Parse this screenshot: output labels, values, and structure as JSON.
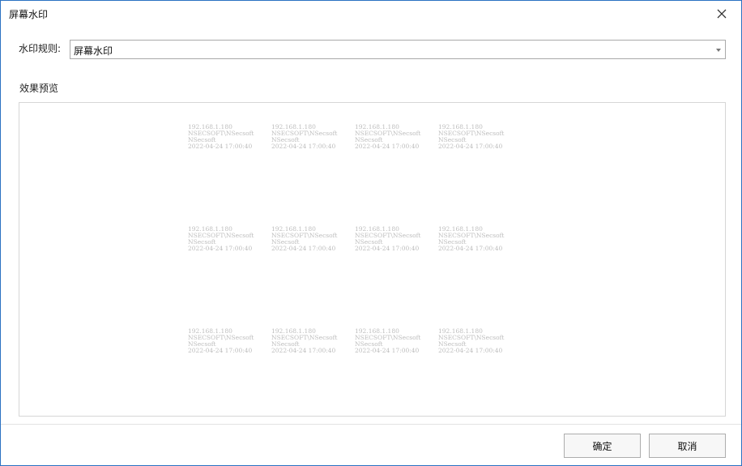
{
  "window": {
    "title": "屏幕水印"
  },
  "rule": {
    "label": "水印规则:",
    "selected": "屏幕水印"
  },
  "preview": {
    "label": "效果预览",
    "watermark_lines": [
      "192.168.1.180",
      "NSECSOFT\\NSecsoft",
      "NSecsoft",
      "2022-04-24 17:00:40"
    ]
  },
  "footer": {
    "ok_label": "确定",
    "cancel_label": "取消"
  },
  "icons": {
    "close": "close-icon",
    "dropdown": "chevron-down-icon"
  },
  "colors": {
    "window_border": "#2b72c2",
    "watermark_text": "#bdbdbd"
  }
}
